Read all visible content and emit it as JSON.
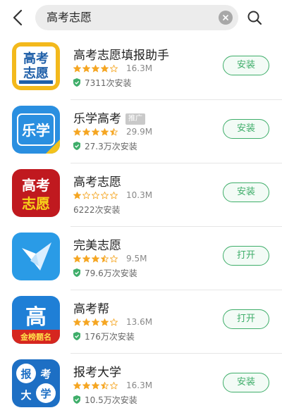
{
  "search": {
    "query": "高考志愿"
  },
  "colors": {
    "accent": "#3fae6a",
    "star": "#f5a623",
    "shield": "#3fae6a"
  },
  "apps": [
    {
      "name": "高考志愿填报助手",
      "rating": 4.0,
      "size": "16.3M",
      "downloads": "7311次安装",
      "verified": true,
      "badge": "",
      "action": "安装",
      "icon": "icon-yellow-gaokao-zhiyuan",
      "icon_text": [
        "高考",
        "志愿"
      ]
    },
    {
      "name": "乐学高考",
      "rating": 4.5,
      "size": "29.9M",
      "downloads": "27.3万次安装",
      "verified": true,
      "badge": "推广",
      "action": "安装",
      "icon": "icon-blue-lexue",
      "icon_text": [
        "乐学"
      ]
    },
    {
      "name": "高考志愿",
      "rating": 1.0,
      "size": "10.3M",
      "downloads": "6222次安装",
      "verified": false,
      "badge": "",
      "action": "安装",
      "icon": "icon-red-gaokao-zhiyuan",
      "icon_text": [
        "高考",
        "志愿"
      ]
    },
    {
      "name": "完美志愿",
      "rating": 3.5,
      "size": "9.5M",
      "downloads": "79.6万次安装",
      "verified": true,
      "badge": "",
      "action": "打开",
      "icon": "icon-blue-paper-crane",
      "icon_text": []
    },
    {
      "name": "高考帮",
      "rating": 4.0,
      "size": "13.6M",
      "downloads": "176万次安装",
      "verified": true,
      "badge": "",
      "action": "打开",
      "icon": "icon-blue-gao",
      "icon_text": [
        "高",
        "金榜题名"
      ]
    },
    {
      "name": "报考大学",
      "rating": 3.5,
      "size": "16.3M",
      "downloads": "10.5万次安装",
      "verified": true,
      "badge": "",
      "action": "安装",
      "icon": "icon-blue-baokao-daxue",
      "icon_text": [
        "报",
        "考",
        "大",
        "学"
      ]
    }
  ]
}
